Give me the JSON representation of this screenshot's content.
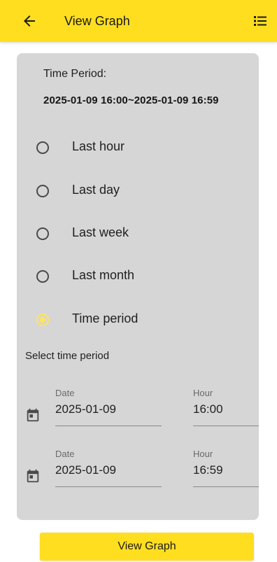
{
  "appbar": {
    "title": "View Graph",
    "back_icon": "arrow-left-icon",
    "menu_icon": "list-icon"
  },
  "card": {
    "period_label": "Time Period:",
    "period_value": "2025-01-09 16:00~2025-01-09 16:59",
    "options": [
      {
        "label": "Last hour",
        "selected": false
      },
      {
        "label": "Last day",
        "selected": false
      },
      {
        "label": "Last week",
        "selected": false
      },
      {
        "label": "Last month",
        "selected": false
      },
      {
        "label": "Time period",
        "selected": true
      }
    ],
    "select_label": "Select time period",
    "start": {
      "date_label": "Date",
      "date_value": "2025-01-09",
      "hour_label": "Hour",
      "hour_value": "16:00"
    },
    "end": {
      "date_label": "Date",
      "date_value": "2025-01-09",
      "hour_label": "Hour",
      "hour_value": "16:59"
    }
  },
  "footer": {
    "button_label": "View Graph"
  },
  "colors": {
    "accent": "#ffde1f",
    "card_bg": "#d6d6d6",
    "radio_selected": "#ffe45c"
  }
}
